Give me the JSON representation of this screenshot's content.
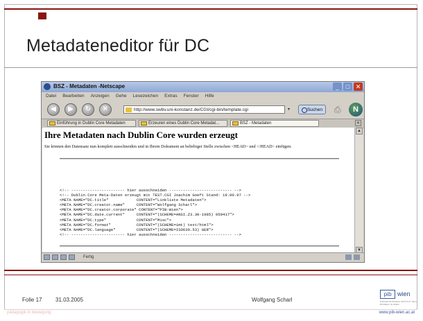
{
  "slide": {
    "title": "Metadateneditor für DC",
    "footer": {
      "slide_label": "Folie 17",
      "date": "31.03.2005",
      "author": "Wolfgang Scharl",
      "logo_box": "pib",
      "logo_word": "wien",
      "logo_sub": "PÄDAGOGISCHES INSTITUT DES BUNDES IN WIEN",
      "slogan": "pädagogik in bewegung",
      "url": "www.pib-wien.ac.at"
    },
    "colors": {
      "accent": "#8a1414",
      "link": "#3a5a9a"
    }
  },
  "browser": {
    "window_title": "BSZ - Metadaten -Netscape",
    "menu": [
      "Datei",
      "Bearbeiten",
      "Anzeigen",
      "Gehe",
      "Lesezeichen",
      "Extras",
      "Fenster",
      "Hilfe"
    ],
    "nav_icons": [
      "back-icon",
      "forward-icon",
      "reload-icon",
      "stop-icon"
    ],
    "url": "http://www.swbv.uni-konstanz.de/CGI/cgi-bin/template.cgi",
    "search_label": "Suchen",
    "tabs": [
      {
        "label": "Einführung in Dublin Core Metadaten"
      },
      {
        "label": "Erzeuren eines Dublin Core Metadat..."
      },
      {
        "label": "BSZ - Metadaten"
      }
    ],
    "page": {
      "heading": "Ihre Metadaten nach Dublin Core wurden erzeugt",
      "intro": "Sie können den Datensatz nun komplett ausschneiden und in Ihrem Dokument an beliebiger Stelle zwischen <HEAD> und </HEAD> einfügen.",
      "code_lines": [
        "<!-- ----------------------- hier ausschneiden --------------------------- -->",
        "<!-- Dublin Core Meta-Daten erzeugt mit TEST.CGI Joachim Goeft Stand: 19.00.97 -->",
        "<META NAME=\"DC.title\"            CONTENT=\"Linkliste Metadaten\">",
        "<META NAME=\"DC.creator.name\"     CONTENT=\"Wolfgang Scharl\">",
        "<META NAME=\"DC.creator.corporate\" CONTENT=\"PIB-Wien\">",
        "<META NAME=\"DC.date.current\"     CONTENT=\"(SCHEME=ANSI.Z3.30-1985) 050417\">",
        "<META NAME=\"DC.type\"             CONTENT=\"Misc\">",
        "<META NAME=\"DC.format\"           CONTENT=\"(SCHEME=imt) text/html\">",
        "<META NAME=\"DC.language\"         CONTENT=\"(SCHEME=ISO639.53) GER\">",
        "<!-- ----------------------- hier ausschneiden --------------------------- -->"
      ]
    },
    "status_text": "Fertig"
  }
}
